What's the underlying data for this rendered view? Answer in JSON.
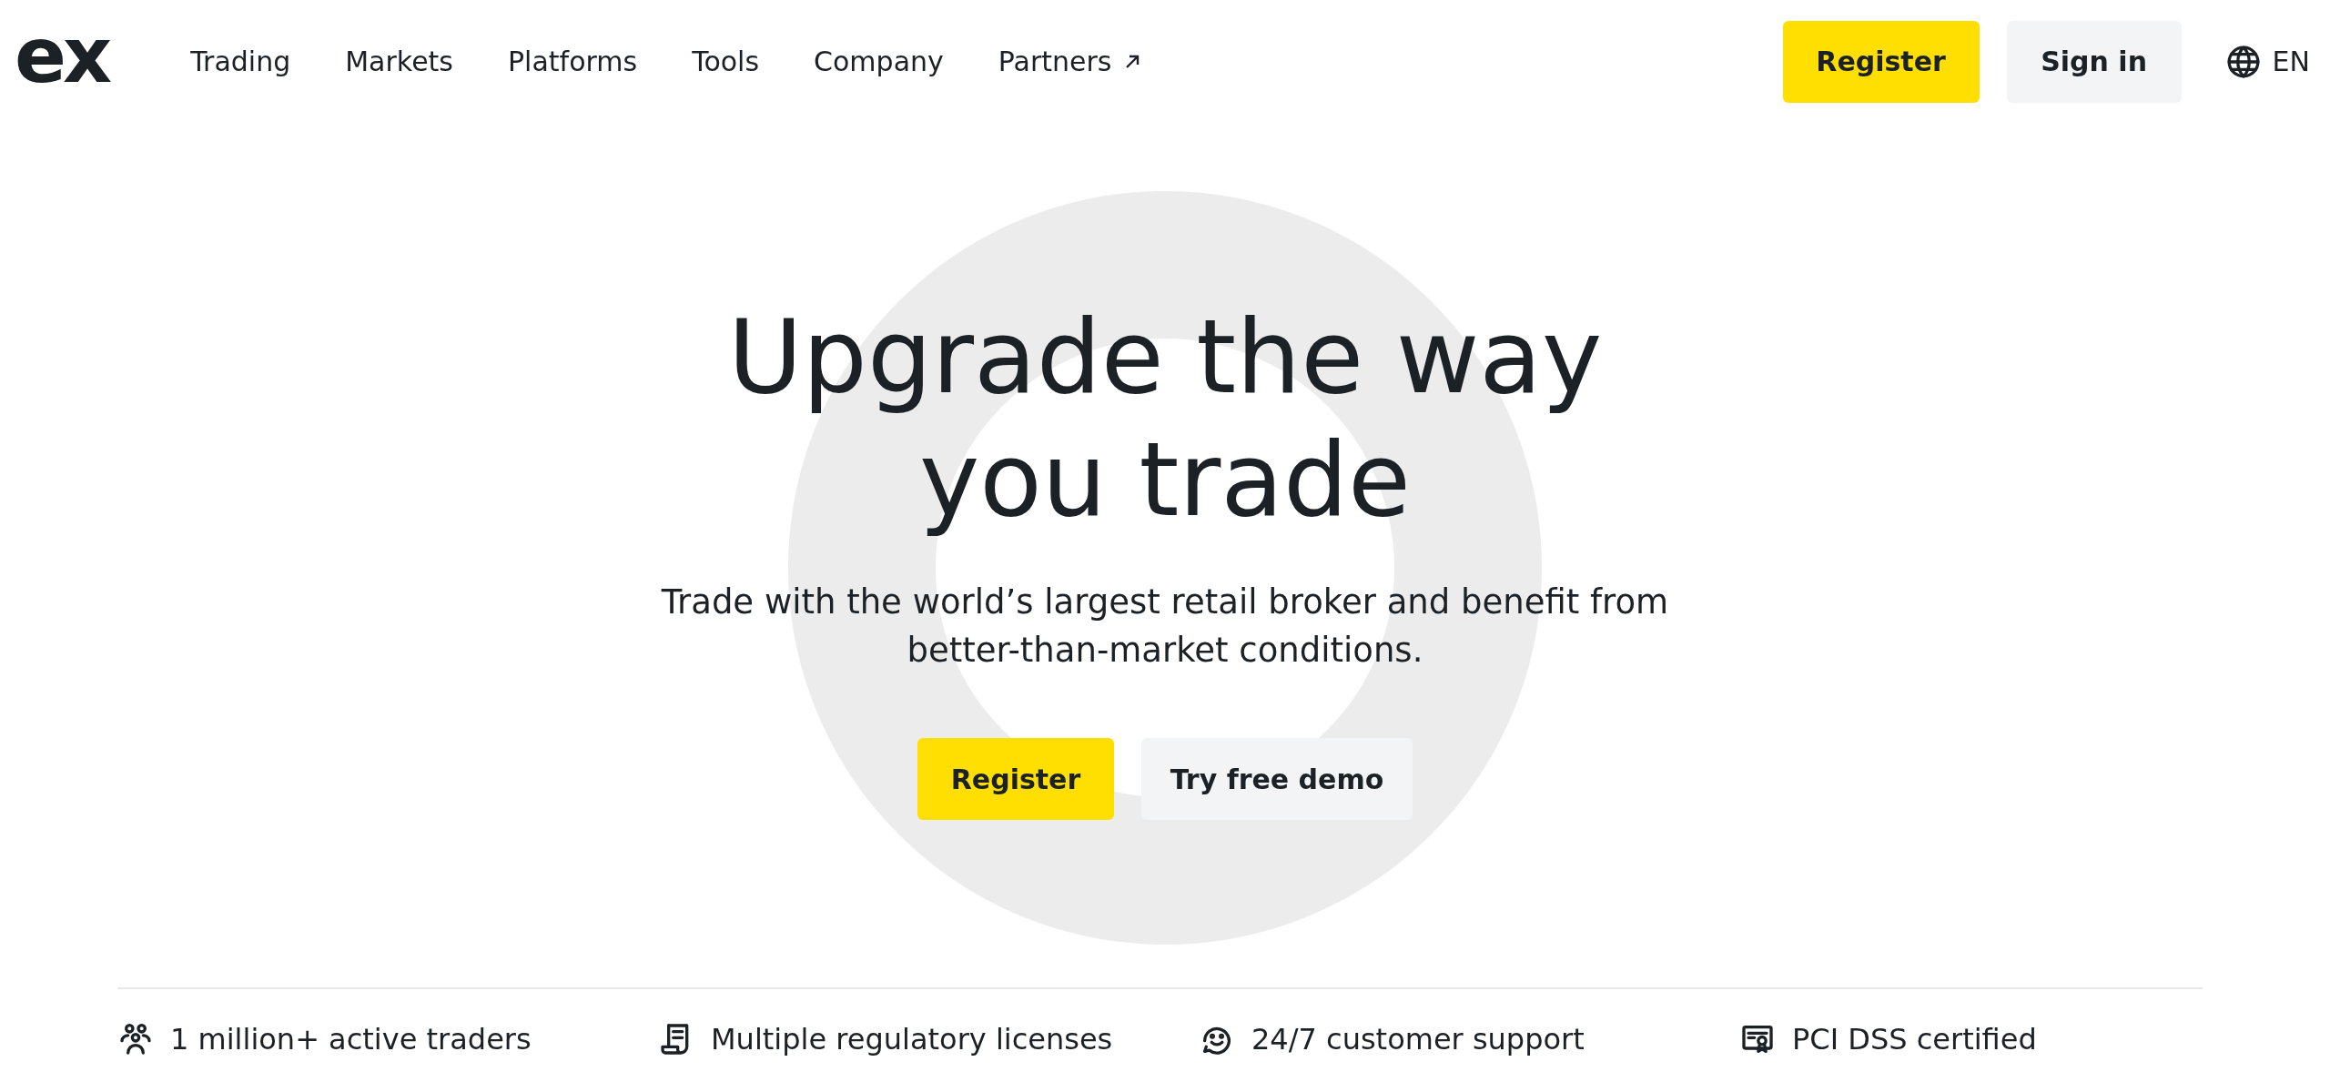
{
  "header": {
    "logo": "ex",
    "nav": [
      {
        "label": "Trading",
        "external": false
      },
      {
        "label": "Markets",
        "external": false
      },
      {
        "label": "Platforms",
        "external": false
      },
      {
        "label": "Tools",
        "external": false
      },
      {
        "label": "Company",
        "external": false
      },
      {
        "label": "Partners",
        "external": true
      }
    ],
    "buttons": [
      {
        "label": "Register",
        "kind": "primary"
      },
      {
        "label": "Sign in",
        "kind": "secondary"
      }
    ],
    "language": "EN"
  },
  "hero": {
    "title_lines": [
      "Upgrade the way",
      "you trade"
    ],
    "subtitle": "Trade with the world’s largest retail broker and benefit from better-than-market conditions.",
    "buttons": [
      {
        "label": "Register",
        "kind": "primary"
      },
      {
        "label": "Try free demo",
        "kind": "secondary"
      }
    ]
  },
  "features": [
    {
      "kind": "people",
      "text": "1 million+ active traders"
    },
    {
      "kind": "license",
      "text": "Multiple regulatory licenses"
    },
    {
      "kind": "support",
      "text": "24/7 customer support"
    },
    {
      "kind": "certificate",
      "text": "PCI DSS certified"
    }
  ]
}
